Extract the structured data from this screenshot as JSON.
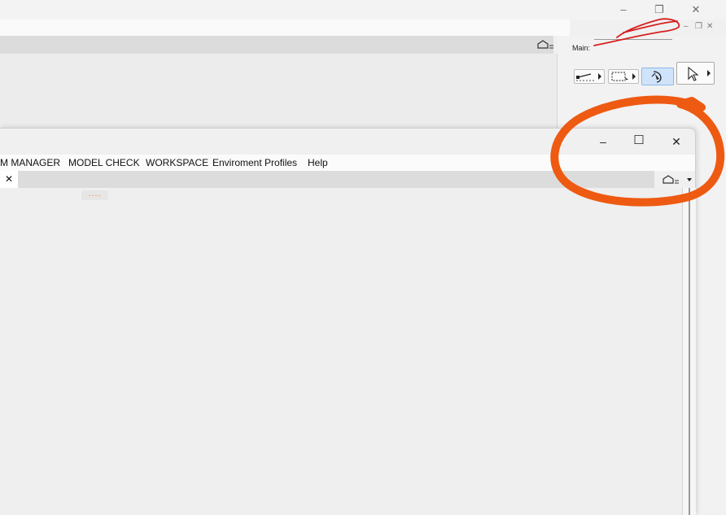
{
  "background_window": {
    "controls": {
      "minimize": "–",
      "restore": "❐",
      "close": "✕"
    },
    "panel_controls": {
      "minimize": "–",
      "restore": "❐",
      "close": "✕"
    },
    "main_label": "Main:",
    "toolbar_icons": [
      "line-tool-icon",
      "marquee-tool-icon",
      "orbit-tool-icon",
      "arrow-select-icon"
    ],
    "view_settings_icon": "house-view-icon"
  },
  "foreground_window": {
    "controls": {
      "minimize": "–",
      "maximize": "☐",
      "close": "✕"
    },
    "menu": [
      "M MANAGER",
      "MODEL CHECK",
      "WORKSPACE",
      "Enviroment Profiles",
      "Help"
    ],
    "tab_close": "✕",
    "marker_text": "----",
    "view_settings_icon": "house-view-icon"
  },
  "annotations": {
    "red_scribble_color": "#d62020",
    "orange_circle_color": "#ee5a12"
  }
}
